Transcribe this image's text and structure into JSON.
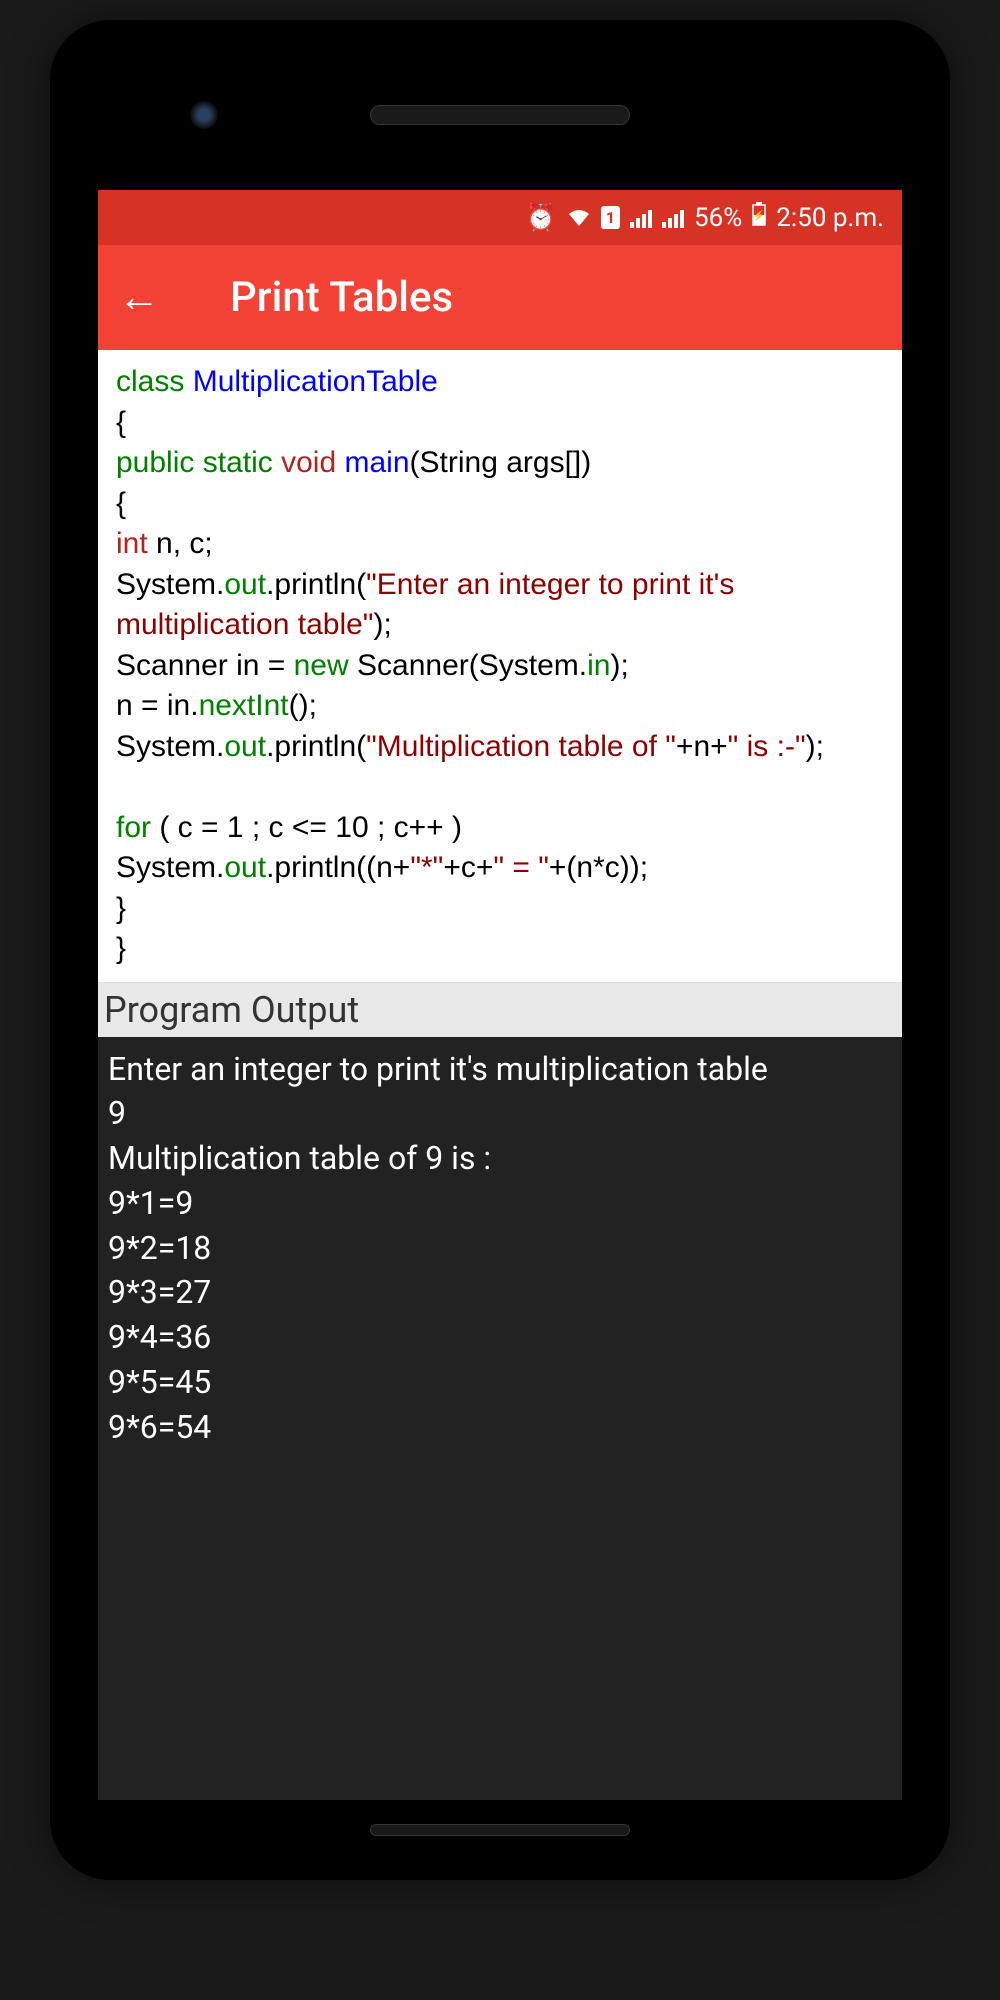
{
  "statusBar": {
    "battery": "56%",
    "time": "2:50 p.m.",
    "simBadge": "1"
  },
  "appBar": {
    "title": "Print Tables"
  },
  "code": {
    "t_class": "class",
    "t_className": "MultiplicationTable",
    "t_brace_open": "{",
    "t_public": "public",
    "t_static": "static",
    "t_void": "void",
    "t_main": "main",
    "t_mainArgs": "(String args[])",
    "t_brace_open2": "{",
    "t_int": "int",
    "t_intVars": " n, c;",
    "t_system": "System.",
    "t_out": "out",
    "t_println": ".println(",
    "t_str1": "\"Enter an integer to print it's multiplication table\"",
    "t_close_paren": ");",
    "t_scannerDecl1": "Scanner in = ",
    "t_new": "new",
    "t_scannerDecl2": " Scanner(System.",
    "t_in": "in",
    "t_scannerDecl3": ");",
    "t_n_assign1": "n = in.",
    "t_nextInt": "nextInt",
    "t_n_assign2": "();",
    "t_str2": "\"Multiplication table of \"",
    "t_plus_n_plus": "+n+",
    "t_str2b": "\" is :-\"",
    "t_for": "for",
    "t_forArgs": " ( c = 1 ; c <= 10 ; c++ )",
    "t_printlnBody1": "(n+",
    "t_str_star": "\"*\"",
    "t_printlnBody2": "+c+",
    "t_str_eq": "\" = \"",
    "t_printlnBody3": "+(n*c));",
    "t_brace_close1": "}",
    "t_brace_close2": "}"
  },
  "output": {
    "header": "Program Output",
    "line1": "Enter an integer to print it's multiplication table",
    "line2": "9",
    "line3": "Multiplication table of 9 is :",
    "line4": "9*1=9",
    "line5": "9*2=18",
    "line6": "9*3=27",
    "line7": "9*4=36",
    "line8": "9*5=45",
    "line9": "9*6=54"
  }
}
